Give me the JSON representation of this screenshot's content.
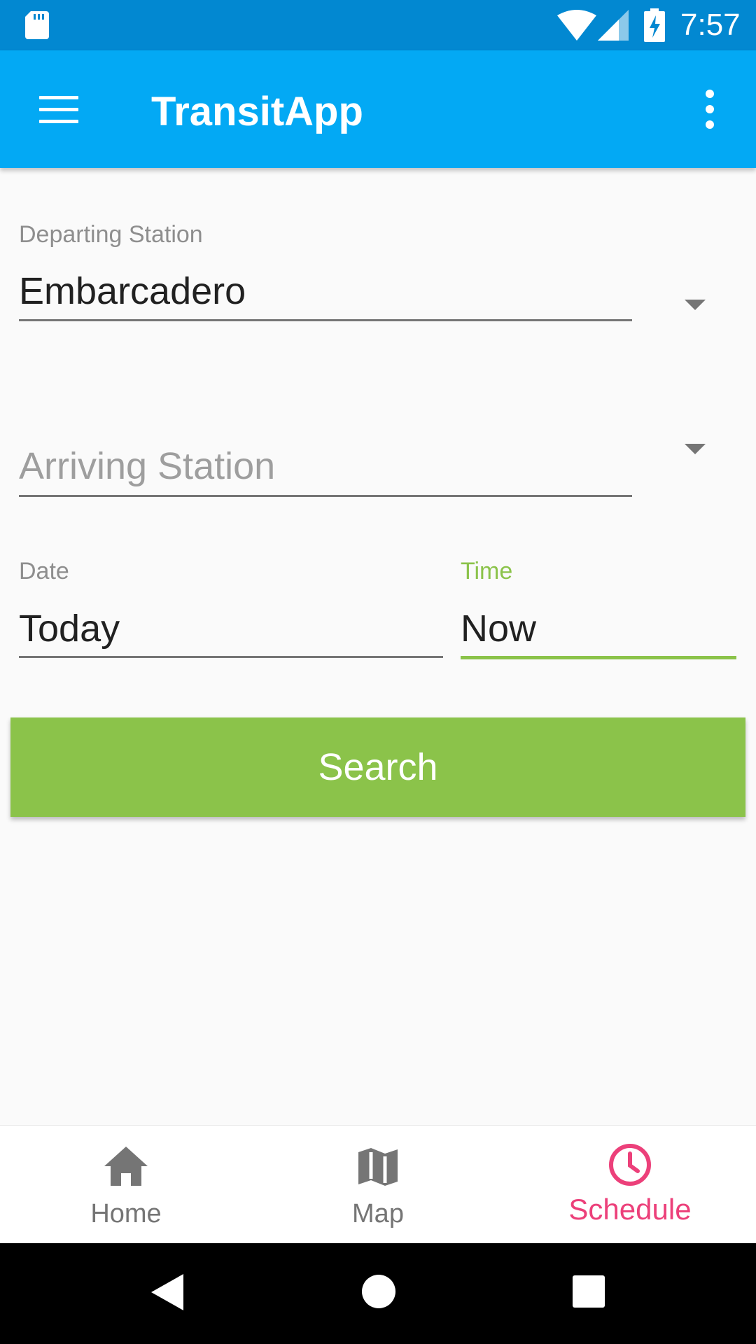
{
  "status_bar": {
    "time": "7:57",
    "icons": [
      "sd-card-icon",
      "wifi-icon",
      "cellular-signal-icon",
      "battery-charging-icon"
    ]
  },
  "app_bar": {
    "title": "TransitApp",
    "icons": [
      "hamburger-menu-icon",
      "more-vert-icon"
    ],
    "background_color": "#03a9f4"
  },
  "form": {
    "departing": {
      "label": "Departing Station",
      "value": "Embarcadero"
    },
    "arriving": {
      "placeholder": "Arriving Station",
      "value": ""
    },
    "date": {
      "label": "Date",
      "value": "Today"
    },
    "time": {
      "label": "Time",
      "value": "Now",
      "focused": true,
      "accent_color": "#8bc34a"
    },
    "search_button": {
      "label": "Search",
      "color": "#8bc34a"
    }
  },
  "bottom_nav": {
    "items": [
      {
        "label": "Home",
        "icon": "home-icon",
        "active": false
      },
      {
        "label": "Map",
        "icon": "map-icon",
        "active": false
      },
      {
        "label": "Schedule",
        "icon": "clock-icon",
        "active": true
      }
    ],
    "active_color": "#ec407a",
    "inactive_color": "#757575"
  },
  "system_nav": {
    "icons": [
      "back-icon",
      "home-circle-icon",
      "recents-icon"
    ]
  }
}
